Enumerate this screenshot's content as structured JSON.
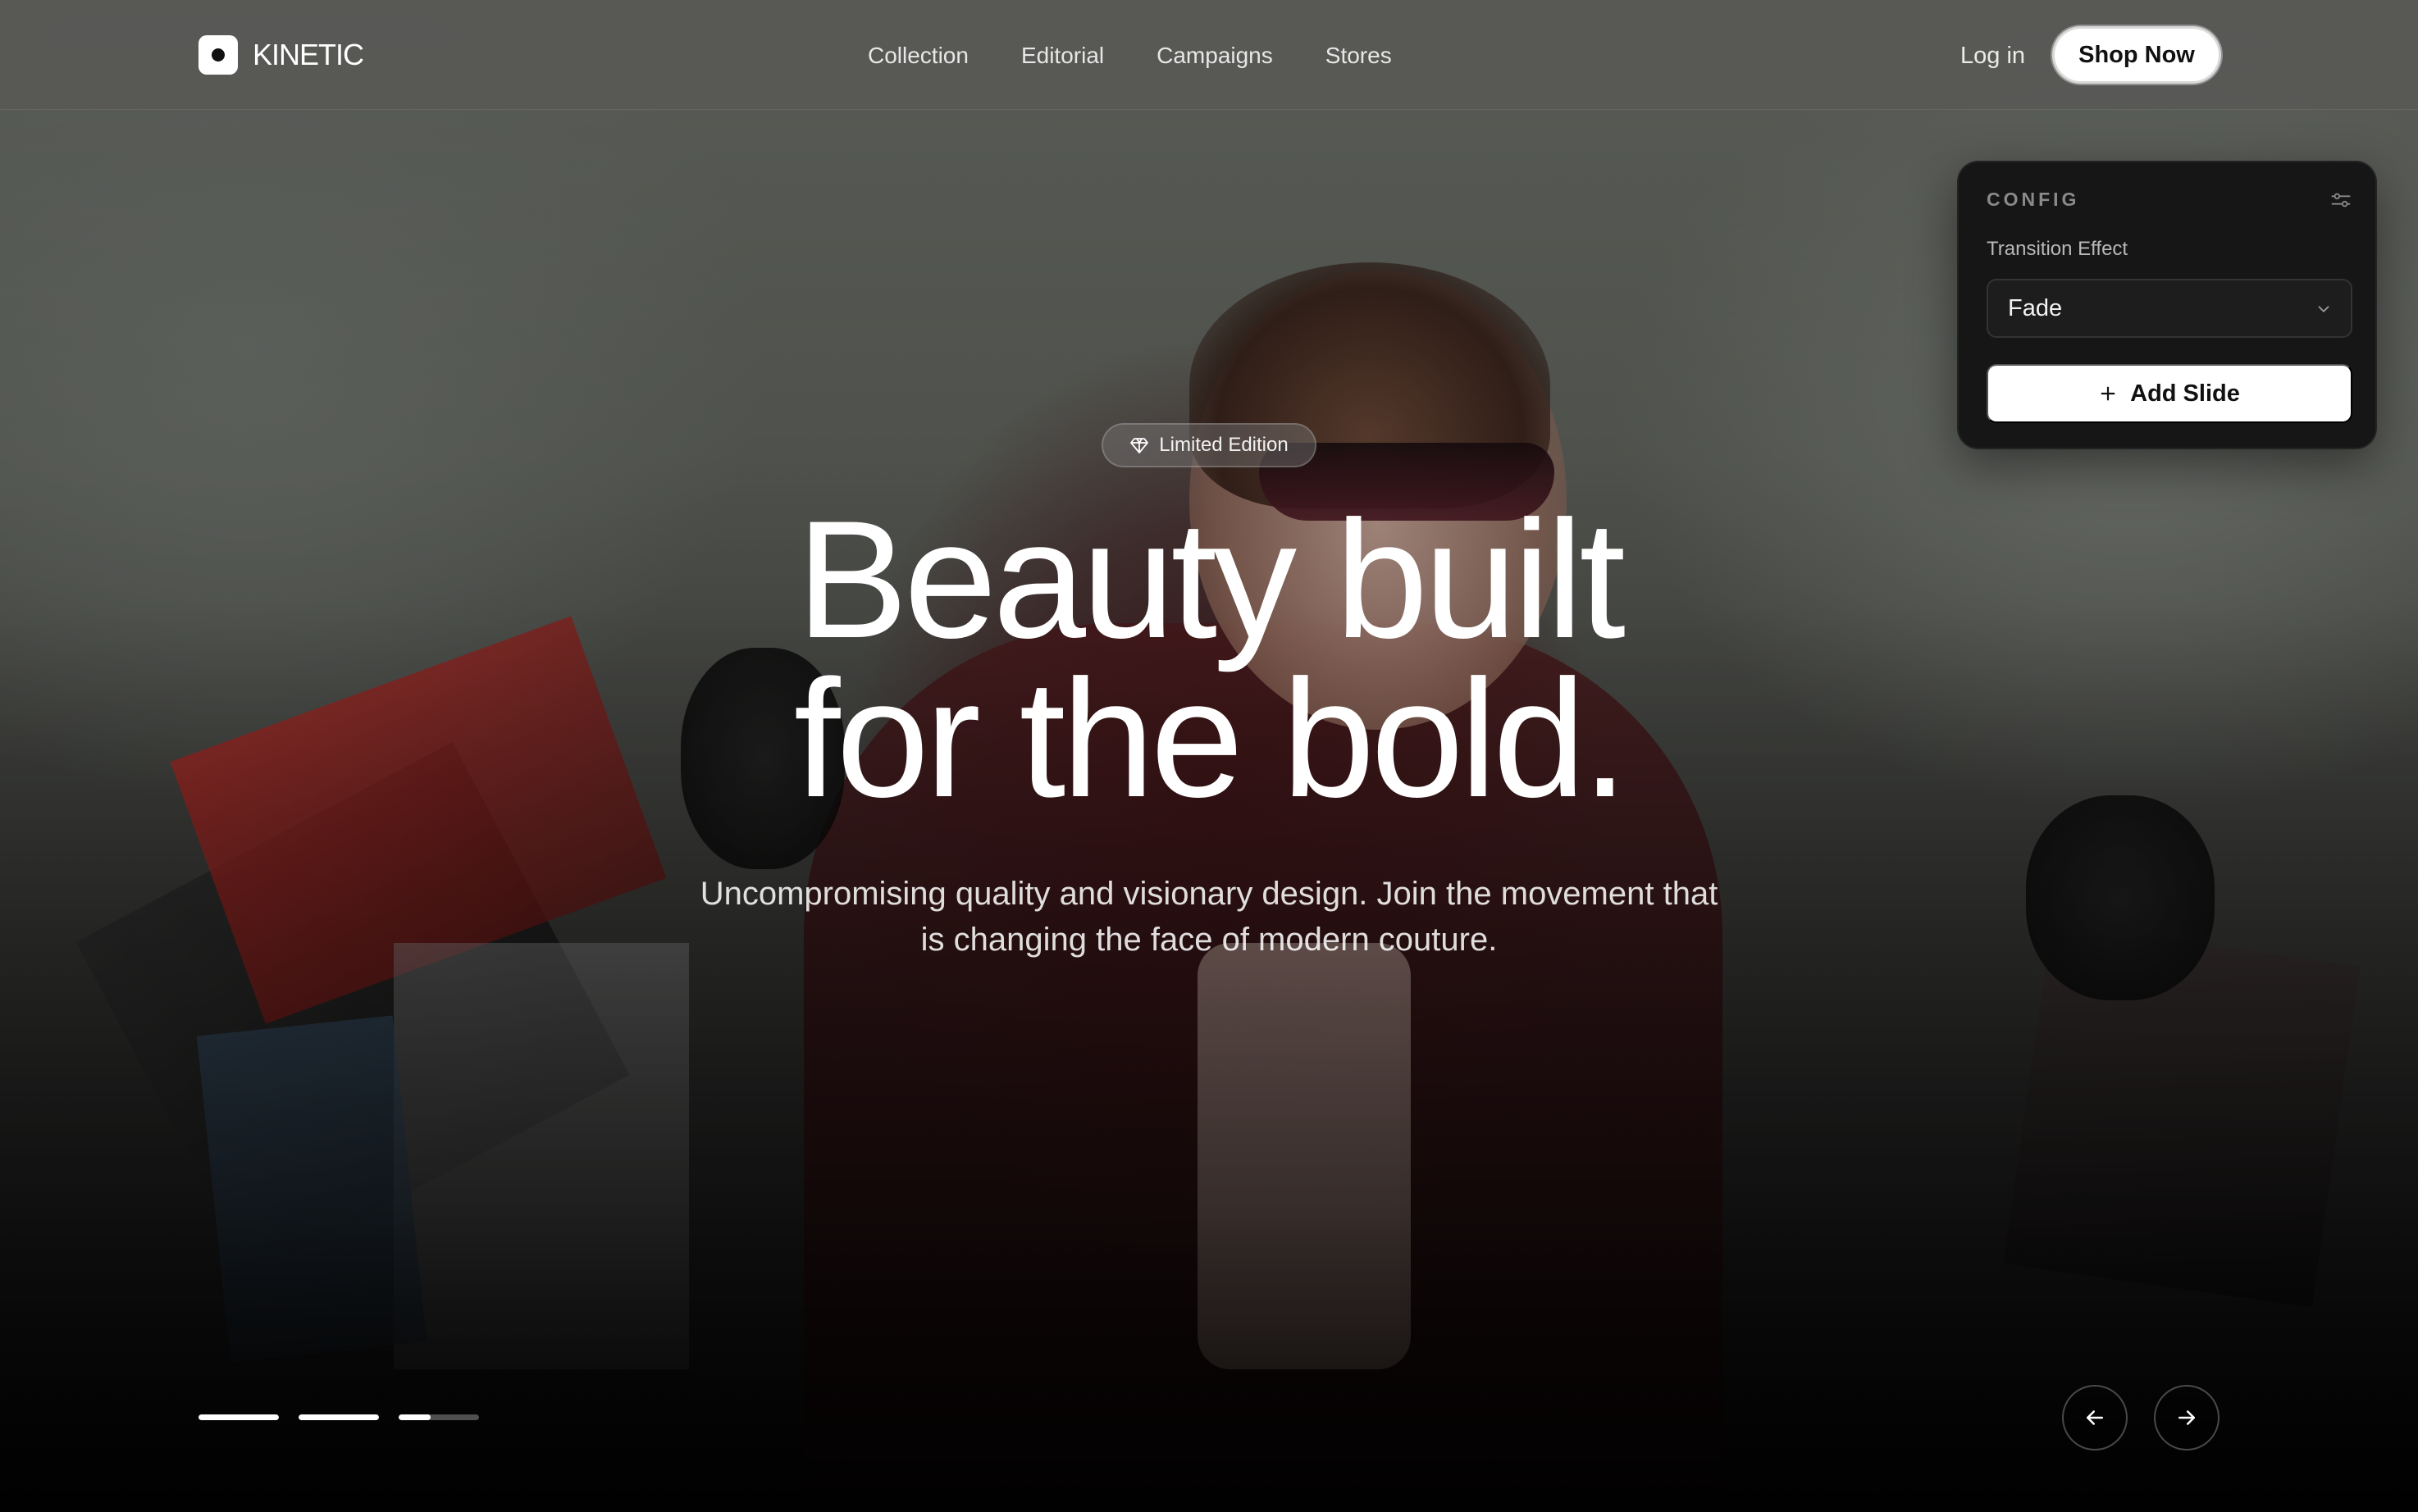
{
  "nav": {
    "brand": "KINETIC",
    "links": [
      "Collection",
      "Editorial",
      "Campaigns",
      "Stores"
    ],
    "login_label": "Log in",
    "cta_label": "Shop Now"
  },
  "config": {
    "title": "CONFIG",
    "field_label": "Transition Effect",
    "selected_effect": "Fade",
    "add_slide_label": "Add Slide"
  },
  "hero": {
    "badge": "Limited Edition",
    "headline_line1": "Beauty built",
    "headline_line2": "for the bold.",
    "subtitle_line1": "Uncompromising quality and visionary design. Join the movement that",
    "subtitle_line2": "is changing the face of modern couture."
  },
  "slider": {
    "slides": [
      {
        "progress": 1.0
      },
      {
        "progress": 1.0
      },
      {
        "progress": 0.4
      }
    ]
  },
  "icons": {
    "brand": "brand-logo-icon",
    "settings": "sliders-icon",
    "select": "chevron-down-icon",
    "add": "plus-icon",
    "badge": "gem-icon",
    "prev": "arrow-left-icon",
    "next": "arrow-right-icon"
  },
  "colors": {
    "cta_bg": "#ffffff",
    "panel_bg": "#161616",
    "text": "#ffffff"
  }
}
